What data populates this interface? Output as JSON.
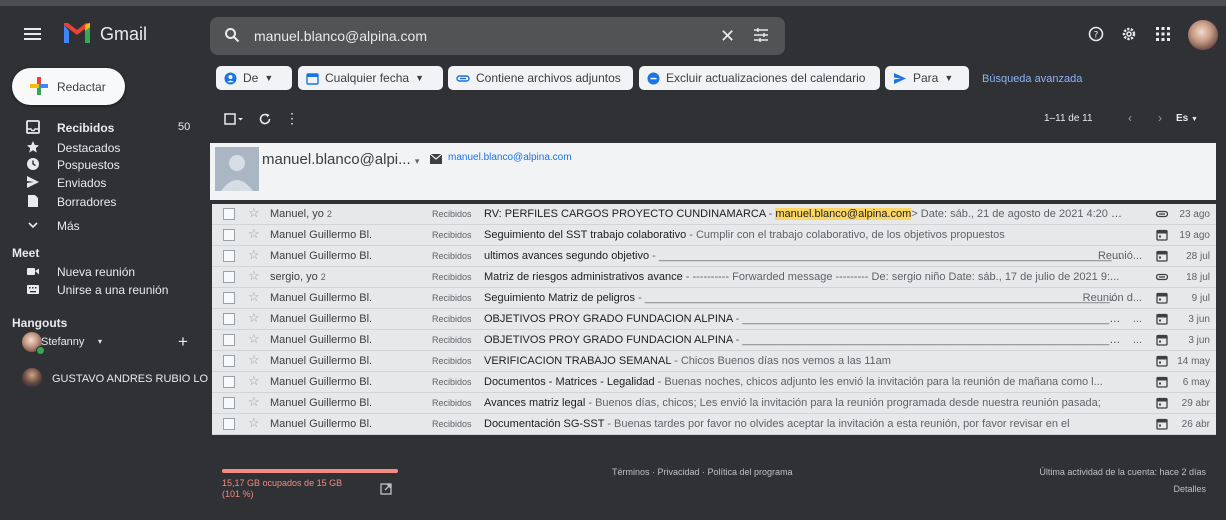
{
  "app": {
    "name": "Gmail"
  },
  "search": {
    "query": "manuel.blanco@alpina.com"
  },
  "sidebar": {
    "compose_label": "Redactar",
    "items": [
      {
        "label": "Recibidos",
        "count": "50",
        "icon": "inbox-icon"
      },
      {
        "label": "Destacados",
        "icon": "star-icon"
      },
      {
        "label": "Pospuestos",
        "icon": "clock-icon"
      },
      {
        "label": "Enviados",
        "icon": "send-icon"
      },
      {
        "label": "Borradores",
        "icon": "draft-icon"
      },
      {
        "label": "Más",
        "icon": "chevron-down-icon"
      }
    ],
    "meet": {
      "title": "Meet",
      "items": [
        {
          "label": "Nueva reunión",
          "icon": "video-icon"
        },
        {
          "label": "Unirse a una reunión",
          "icon": "keyboard-icon"
        }
      ]
    },
    "hangouts": {
      "title": "Hangouts",
      "user": "Stefanny",
      "contacts": [
        {
          "name": "GUSTAVO ANDRES RUBIO LO"
        }
      ]
    }
  },
  "filters": {
    "chips": [
      "De",
      "Cualquier fecha",
      "Contiene archivos adjuntos",
      "Excluir actualizaciones del calendario",
      "Para"
    ],
    "advanced": "Búsqueda avanzada"
  },
  "toolbar": {
    "range": "1–11 de 11",
    "lang": "Es"
  },
  "contact": {
    "name": "manuel.blanco@alpi...",
    "email": "manuel.blanco@alpina.com"
  },
  "emails": [
    {
      "sender": "Manuel, yo",
      "count": "2",
      "label": "Recibidos",
      "subject": "RV: PERFILES CARGOS PROYECTO CUNDINAMARCA",
      "snippet_pre": " - ",
      "highlight": "manuel.blanco@alpina.com",
      "snippet": "> Date: sáb., 21 de agosto de 2021 4:20 p. ...",
      "right_text": "",
      "icon": "attachment-icon",
      "date": "23 ago"
    },
    {
      "sender": "Manuel Guillermo Bl.",
      "count": "",
      "label": "Recibidos",
      "subject": "Seguimiento del SST trabajo colaborativo",
      "snippet_pre": " - ",
      "highlight": "",
      "snippet": "Cumplir con el trabajo colaborativo, de los objetivos propuestos",
      "right_text": "",
      "icon": "calendar-icon",
      "date": "19 ago"
    },
    {
      "sender": "Manuel Guillermo Bl.",
      "count": "",
      "label": "Recibidos",
      "subject": "ultimos avances segundo objetivo",
      "snippet_pre": " - ",
      "highlight": "",
      "snippet": "______________________________________________________________________________________________",
      "right_text": "Reunió...",
      "icon": "calendar-icon",
      "date": "28 jul"
    },
    {
      "sender": "sergio, yo",
      "count": "2",
      "label": "Recibidos",
      "subject": "Matriz de riesgos administrativos avance",
      "snippet_pre": " - ",
      "highlight": "",
      "snippet": "---------- Forwarded message --------- De: sergio niño Date: sáb., 17 de julio de 2021 9:...",
      "right_text": "",
      "icon": "attachment-icon",
      "date": "18 jul"
    },
    {
      "sender": "Manuel Guillermo Bl.",
      "count": "",
      "label": "Recibidos",
      "subject": "Seguimiento Matriz de peligros",
      "snippet_pre": " - ",
      "highlight": "",
      "snippet": "_____________________________________________________________________________________",
      "right_text": "Reunión d...",
      "icon": "calendar-icon",
      "date": "9 jul"
    },
    {
      "sender": "Manuel Guillermo Bl.",
      "count": "",
      "label": "Recibidos",
      "subject": "OBJETIVOS PROY GRADO FUNDACION ALPINA",
      "snippet_pre": " - ",
      "highlight": "",
      "snippet": "______________________________________________________________________________________",
      "right_text": "...",
      "icon": "calendar-icon",
      "date": "3 jun"
    },
    {
      "sender": "Manuel Guillermo Bl.",
      "count": "",
      "label": "Recibidos",
      "subject": "OBJETIVOS PROY GRADO FUNDACION ALPINA",
      "snippet_pre": " - ",
      "highlight": "",
      "snippet": "______________________________________________________________________________________",
      "right_text": "...",
      "icon": "calendar-icon",
      "date": "3 jun"
    },
    {
      "sender": "Manuel Guillermo Bl.",
      "count": "",
      "label": "Recibidos",
      "subject": "VERIFICACION TRABAJO SEMANAL",
      "snippet_pre": " - ",
      "highlight": "",
      "snippet": "Chicos Buenos días nos vemos a las 11am",
      "right_text": "",
      "icon": "calendar-icon",
      "date": "14 may"
    },
    {
      "sender": "Manuel Guillermo Bl.",
      "count": "",
      "label": "Recibidos",
      "subject": "Documentos - Matrices - Legalidad",
      "snippet_pre": " - ",
      "highlight": "",
      "snippet": "Buenas noches, chicos adjunto les envió la invitación para la reunión de mañana como l...",
      "right_text": "",
      "icon": "calendar-icon",
      "date": "6 may"
    },
    {
      "sender": "Manuel Guillermo Bl.",
      "count": "",
      "label": "Recibidos",
      "subject": "Avances matriz legal",
      "snippet_pre": " - ",
      "highlight": "",
      "snippet": "Buenos días, chicos; Les envió la invitación para la reunión programada desde nuestra reunión pasada;",
      "right_text": "",
      "icon": "calendar-icon",
      "date": "29 abr"
    },
    {
      "sender": "Manuel Guillermo Bl.",
      "count": "",
      "label": "Recibidos",
      "subject": "Documentación SG-SST",
      "snippet_pre": " - ",
      "highlight": "",
      "snippet": "Buenas tardes por favor no olvides aceptar la invitación a esta reunión, por favor revisar en el",
      "right_text": "",
      "icon": "calendar-icon",
      "date": "26 abr"
    }
  ],
  "footer": {
    "storage": "15,17 GB ocupados de 15 GB (101 %)",
    "storage_fraction": 1.01,
    "terms": "Términos · Privacidad · Política del programa",
    "activity": "Última actividad de la cuenta: hace 2 días",
    "details": "Detalles"
  },
  "colors": {
    "background": "#303134",
    "list_row": "#e7e8e9",
    "accent_blue": "#8ab4f8",
    "highlight": "#fcd663",
    "storage_warning": "#f28b82"
  }
}
